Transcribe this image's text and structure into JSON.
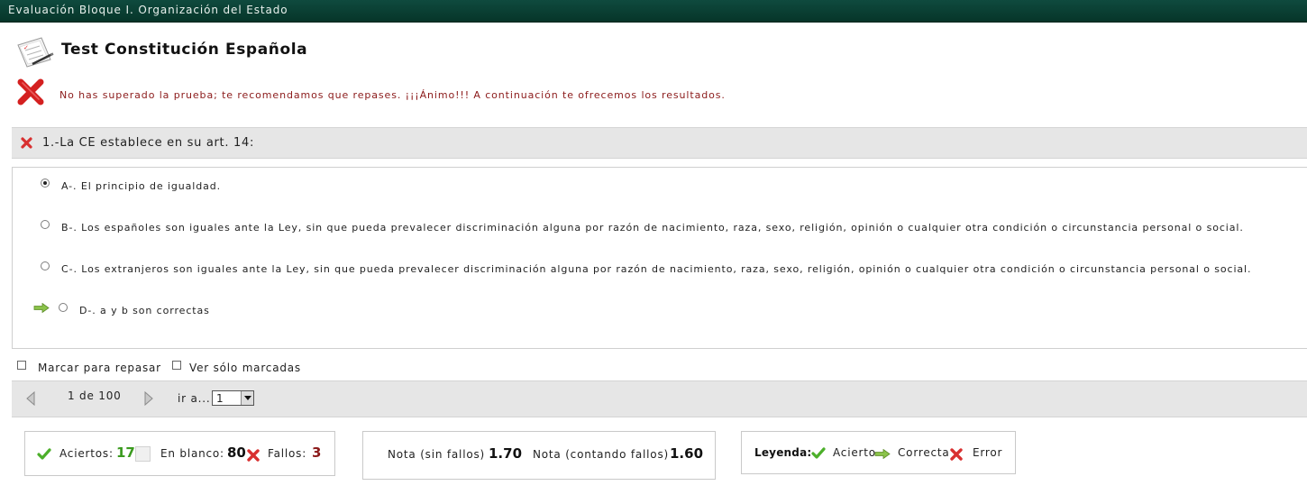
{
  "window": {
    "title": "Evaluación Bloque I. Organización del Estado"
  },
  "test": {
    "title": "Test Constitución Española",
    "result_message": "No has superado la prueba; te recomendamos que repases. ¡¡¡Ánimo!!! A continuación te ofrecemos los resultados."
  },
  "question": {
    "text": "1.-La CE establece en su art. 14:",
    "status": "error",
    "options": [
      {
        "label": "A-. El principio de igualdad.",
        "selected": true,
        "correct": false
      },
      {
        "label": "B-. Los españoles son iguales ante la Ley, sin que pueda prevalecer discriminación alguna por razón de nacimiento, raza, sexo, religión, opinión o cualquier otra condición o circunstancia personal o social.",
        "selected": false,
        "correct": false
      },
      {
        "label": "C-. Los extranjeros son iguales ante la Ley, sin que pueda prevalecer discriminación alguna por razón de nacimiento, raza, sexo, religión, opinión o cualquier otra condición o circunstancia personal o social.",
        "selected": false,
        "correct": false
      },
      {
        "label": "D-. a y b son correctas",
        "selected": false,
        "correct": true
      }
    ]
  },
  "checkboxes": {
    "mark_review": "Marcar para repasar",
    "only_marked": "Ver sólo marcadas"
  },
  "navigation": {
    "page_info": "1 de 100",
    "goto_label": "ir a...",
    "goto_value": "1"
  },
  "stats": {
    "correct_label": "Aciertos:",
    "correct_value": "17",
    "blank_label": "En blanco:",
    "blank_value": "80",
    "errors_label": "Fallos:",
    "errors_value": "3"
  },
  "grades": {
    "no_penalty_label": "Nota (sin fallos)",
    "no_penalty_value": "1.70",
    "with_penalty_label": "Nota (contando fallos)",
    "with_penalty_value": "1.60"
  },
  "legend": {
    "title": "Leyenda:",
    "correct": "Acierto",
    "right_answer": "Correcta",
    "error": "Error"
  },
  "colors": {
    "titlebar": "#0a3f33",
    "success": "#3a9a1e",
    "error": "#8b1a1a",
    "error_icon": "#d92a2a",
    "arrow": "#8bc34a"
  },
  "icons": [
    "test-paper-icon",
    "fail-x-icon",
    "error-x-icon",
    "selected-arrow-icon",
    "prev-icon",
    "next-icon",
    "check-icon",
    "blank-icon",
    "right-arrow-icon"
  ]
}
